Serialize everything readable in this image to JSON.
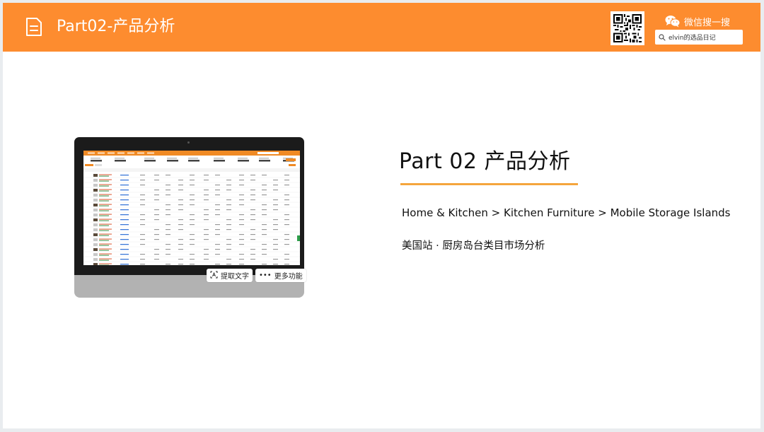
{
  "header": {
    "title": "Part02-产品分析",
    "bg_color": "#fd8c2f",
    "doc_icon": "document-icon",
    "qr_icon": "qr-code-icon",
    "wechat": {
      "icon": "wechat-icon",
      "label": "微信搜一搜",
      "search_icon": "search-icon",
      "search_text": "elvin的选品日记"
    }
  },
  "content": {
    "heading": "Part 02 产品分析",
    "accent_rule_color": "#f5a53c",
    "breadcrumb": "Home & Kitchen > Kitchen Furniture > Mobile Storage Islands",
    "caption": "美国站 · 厨房岛台类目市场分析"
  },
  "laptop_image": {
    "buttons": {
      "extract_text": "提取文字",
      "extract_icon": "text-extract-icon",
      "more_functions": "更多功能",
      "more_icon": "more-dots-icon"
    }
  }
}
